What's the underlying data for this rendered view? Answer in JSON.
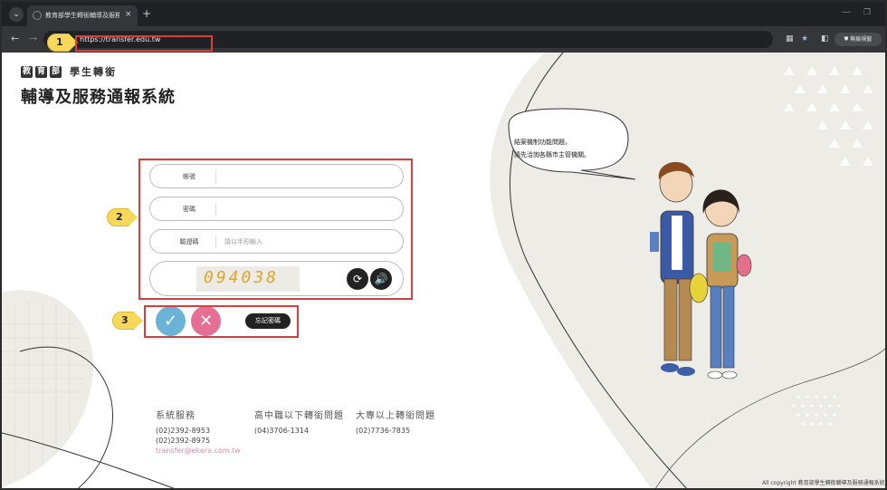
{
  "browser": {
    "tab_title": "教育部學生轉銜輔導及服務通...",
    "tab_close": "×",
    "new_tab": "+",
    "url": "https://transfer.edu.tw",
    "profile": "無痕視窗"
  },
  "markers": [
    "1",
    "2",
    "3"
  ],
  "header": {
    "logo_chars": [
      "教",
      "育",
      "部"
    ],
    "logo_sub": "學生轉銜",
    "title": "輔導及服務通報系統"
  },
  "login": {
    "account_label": "帳號",
    "account_value": "",
    "password_label": "密碼",
    "password_value": "",
    "captcha_label": "驗證碼",
    "captcha_placeholder": "請以半形輸入",
    "captcha_code": "094038"
  },
  "actions": {
    "forgot_label": "忘記密碼"
  },
  "bubble": {
    "line1": "結案機制功能問題，",
    "line2": "請先洽詢各縣市主管機關。"
  },
  "footer": {
    "col1": {
      "heading": "系統服務",
      "lines": [
        "(02)2392-8953",
        "(02)2392-8975"
      ],
      "email": "transfer@ekera.com.tw"
    },
    "col2": {
      "heading": "高中職以下轉銜問題",
      "lines": [
        "(04)3706-1314"
      ]
    },
    "col3": {
      "heading": "大專以上轉銜問題",
      "lines": [
        "(02)7736-7835"
      ]
    },
    "copyright": "All copyright 教育部學生轉銜輔導及服務通報系統"
  },
  "colors": {
    "confirm": "#6bb3d6",
    "cancel": "#e56f95",
    "highlight": "#e03b3b",
    "marker": "#f7d85a"
  },
  "icons": {
    "confirm": "check-icon",
    "cancel": "close-icon",
    "refresh": "refresh-icon",
    "audio": "speaker-icon"
  }
}
